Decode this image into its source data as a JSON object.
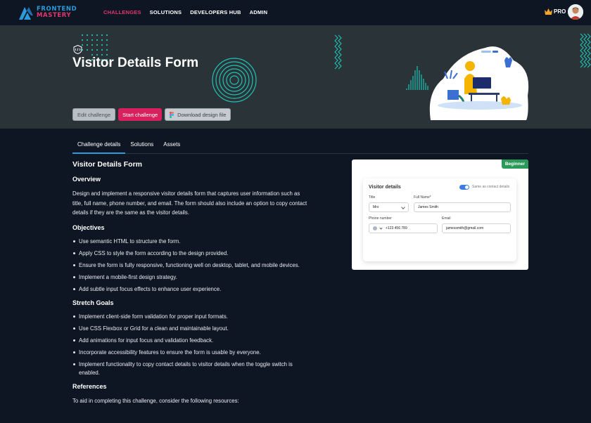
{
  "nav": {
    "logo_line1": "FRONTEND",
    "logo_line2": "MASTERY",
    "links": [
      "CHALLENGES",
      "SOLUTIONS",
      "DEVELOPERS HUB",
      "ADMIN"
    ],
    "pro_label": "PRO"
  },
  "hero": {
    "title": "Visitor Details Form",
    "buttons": {
      "edit": "Edit challenge",
      "start": "Start challenge",
      "download": "Download design file"
    }
  },
  "tabs": [
    "Challenge details",
    "Solutions",
    "Assets"
  ],
  "content": {
    "title": "Visitor Details Form",
    "overview_heading": "Overview",
    "overview_text": "Design and implement a responsive visitor details form that captures user information such as title, full name, phone number, and email. The form should also include an option to copy contact details if they are the same as the visitor details.",
    "objectives_heading": "Objectives",
    "objectives": [
      "Use semantic HTML to structure the form.",
      "Apply CSS to style the form according to the design provided.",
      "Ensure the form is fully responsive, functioning well on desktop, tablet, and mobile devices.",
      "Implement a mobile-first design strategy.",
      "Add subtle input focus effects to enhance user experience."
    ],
    "stretch_heading": "Stretch Goals",
    "stretch_goals": [
      "Implement client-side form validation for proper input formats.",
      "Use CSS Flexbox or Grid for a clean and maintainable layout.",
      "Add animations for input focus and validation feedback.",
      "Incorporate accessibility features to ensure the form is usable by everyone.",
      "Implement functionality to copy contact details to visitor details when the toggle switch is enabled."
    ],
    "references_heading": "References",
    "references_text": "To aid in completing this challenge, consider the following resources:"
  },
  "preview": {
    "level_badge": "Beginner",
    "card_title": "Visitor details",
    "toggle_label": "Same as contact details",
    "title_label": "Title",
    "title_value": "Mrs",
    "fullname_label": "Full Name*",
    "fullname_value": "James Smith",
    "phone_label": "Phone number",
    "phone_value": "+123 456 789",
    "email_label": "Email",
    "email_value": "jamessmith@gmail.com"
  },
  "colors": {
    "accent_pink": "#d8205f",
    "accent_blue": "#2b9bdc",
    "hero_bg": "#2a3438",
    "page_bg": "#0f1623",
    "decor_teal": "#22c2b4",
    "beginner_green": "#2a9a5a"
  }
}
